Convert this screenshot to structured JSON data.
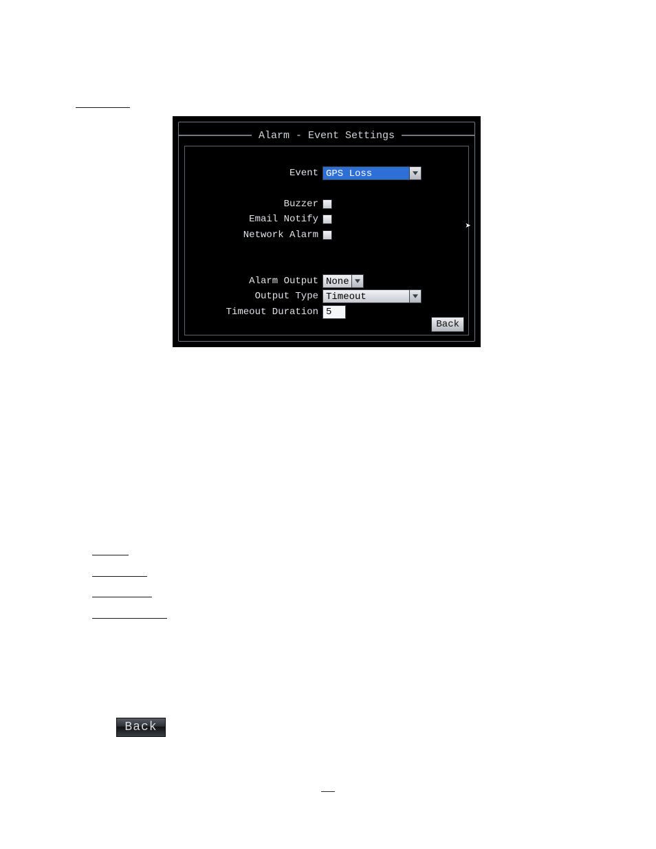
{
  "dialog": {
    "title": "Alarm - Event Settings",
    "fields": {
      "event": {
        "label": "Event",
        "value": "GPS Loss"
      },
      "buzzer": {
        "label": "Buzzer"
      },
      "email_notify": {
        "label": "Email Notify"
      },
      "network_alarm": {
        "label": "Network Alarm"
      },
      "alarm_output": {
        "label": "Alarm Output",
        "value": "None"
      },
      "output_type": {
        "label": "Output Type",
        "value": "Timeout"
      },
      "timeout_duration": {
        "label": "Timeout Duration",
        "value": "5"
      }
    },
    "back_label": "Back"
  },
  "standalone_back_label": "Back"
}
